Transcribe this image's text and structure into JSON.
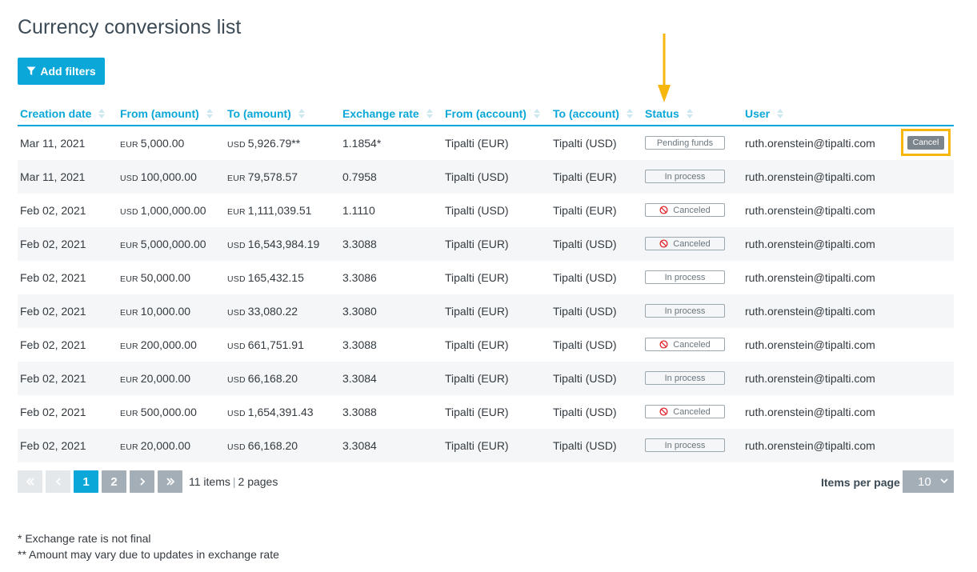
{
  "page": {
    "title": "Currency conversions list"
  },
  "toolbar": {
    "add_filters_label": "Add filters"
  },
  "columns": [
    "Creation date",
    "From (amount)",
    "To (amount)",
    "Exchange rate",
    "From (account)",
    "To (account)",
    "Status",
    "User"
  ],
  "rows": [
    {
      "date": "Mar 11, 2021",
      "from_cur": "EUR",
      "from_amt": "5,000.00",
      "to_cur": "USD",
      "to_amt": "5,926.79**",
      "rate": "1.1854*",
      "from_acct": "Tipalti (EUR)",
      "to_acct": "Tipalti (USD)",
      "status": "Pending funds",
      "user": "ruth.orenstein@tipalti.com",
      "action": "Cancel"
    },
    {
      "date": "Mar 11, 2021",
      "from_cur": "USD",
      "from_amt": "100,000.00",
      "to_cur": "EUR",
      "to_amt": "79,578.57",
      "rate": "0.7958",
      "from_acct": "Tipalti (USD)",
      "to_acct": "Tipalti (EUR)",
      "status": "In process",
      "user": "ruth.orenstein@tipalti.com"
    },
    {
      "date": "Feb 02, 2021",
      "from_cur": "USD",
      "from_amt": "1,000,000.00",
      "to_cur": "EUR",
      "to_amt": "1,111,039.51",
      "rate": "1.1110",
      "from_acct": "Tipalti (USD)",
      "to_acct": "Tipalti (EUR)",
      "status": "Canceled",
      "user": "ruth.orenstein@tipalti.com"
    },
    {
      "date": "Feb 02, 2021",
      "from_cur": "EUR",
      "from_amt": "5,000,000.00",
      "to_cur": "USD",
      "to_amt": "16,543,984.19",
      "rate": "3.3088",
      "from_acct": "Tipalti (EUR)",
      "to_acct": "Tipalti (USD)",
      "status": "Canceled",
      "user": "ruth.orenstein@tipalti.com"
    },
    {
      "date": "Feb 02, 2021",
      "from_cur": "EUR",
      "from_amt": "50,000.00",
      "to_cur": "USD",
      "to_amt": "165,432.15",
      "rate": "3.3086",
      "from_acct": "Tipalti (EUR)",
      "to_acct": "Tipalti (USD)",
      "status": "In process",
      "user": "ruth.orenstein@tipalti.com"
    },
    {
      "date": "Feb 02, 2021",
      "from_cur": "EUR",
      "from_amt": "10,000.00",
      "to_cur": "USD",
      "to_amt": "33,080.22",
      "rate": "3.3080",
      "from_acct": "Tipalti (EUR)",
      "to_acct": "Tipalti (USD)",
      "status": "In process",
      "user": "ruth.orenstein@tipalti.com"
    },
    {
      "date": "Feb 02, 2021",
      "from_cur": "EUR",
      "from_amt": "200,000.00",
      "to_cur": "USD",
      "to_amt": "661,751.91",
      "rate": "3.3088",
      "from_acct": "Tipalti (EUR)",
      "to_acct": "Tipalti (USD)",
      "status": "Canceled",
      "user": "ruth.orenstein@tipalti.com"
    },
    {
      "date": "Feb 02, 2021",
      "from_cur": "EUR",
      "from_amt": "20,000.00",
      "to_cur": "USD",
      "to_amt": "66,168.20",
      "rate": "3.3084",
      "from_acct": "Tipalti (EUR)",
      "to_acct": "Tipalti (USD)",
      "status": "In process",
      "user": "ruth.orenstein@tipalti.com"
    },
    {
      "date": "Feb 02, 2021",
      "from_cur": "EUR",
      "from_amt": "500,000.00",
      "to_cur": "USD",
      "to_amt": "1,654,391.43",
      "rate": "3.3088",
      "from_acct": "Tipalti (EUR)",
      "to_acct": "Tipalti (USD)",
      "status": "Canceled",
      "user": "ruth.orenstein@tipalti.com"
    },
    {
      "date": "Feb 02, 2021",
      "from_cur": "EUR",
      "from_amt": "20,000.00",
      "to_cur": "USD",
      "to_amt": "66,168.20",
      "rate": "3.3084",
      "from_acct": "Tipalti (EUR)",
      "to_acct": "Tipalti (USD)",
      "status": "In process",
      "user": "ruth.orenstein@tipalti.com"
    }
  ],
  "pagination": {
    "pages": [
      "1",
      "2"
    ],
    "current_page": "1",
    "items_text": "11 items",
    "pages_text": "2 pages",
    "items_per_page_label": "Items per page",
    "items_per_page_value": "10"
  },
  "footnotes": {
    "note1": "* Exchange rate is not final",
    "note2": "** Amount may vary due to updates in exchange rate"
  },
  "colors": {
    "accent": "#0ba7d8",
    "annotation": "#f6b60c",
    "button_gray": "#a3aeb6",
    "canceled_icon": "#e0262b"
  },
  "icons": {
    "filter": "filter-icon",
    "sort": "sort-icon",
    "canceled": "no-entry-icon",
    "first": "double-chevron-left-icon",
    "prev": "chevron-left-icon",
    "next": "chevron-right-icon",
    "last": "double-chevron-right-icon",
    "dropdown": "chevron-down-icon"
  }
}
